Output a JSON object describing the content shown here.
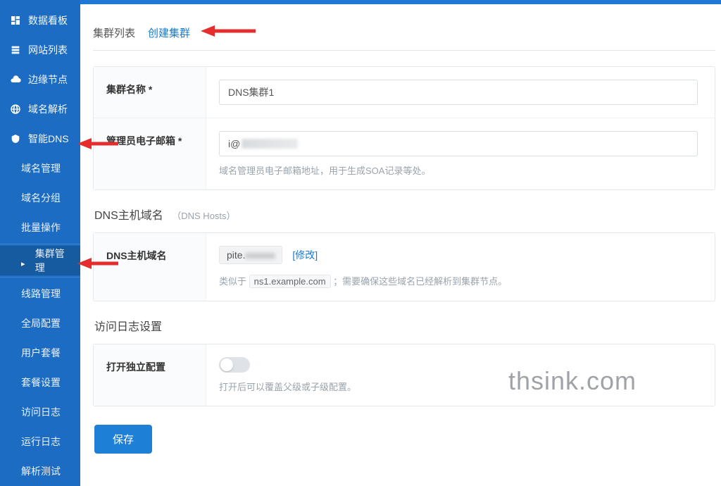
{
  "sidebar": {
    "items": [
      {
        "label": "数据看板",
        "icon": "dashboard"
      },
      {
        "label": "网站列表",
        "icon": "sites"
      },
      {
        "label": "边缘节点",
        "icon": "cloud"
      },
      {
        "label": "域名解析",
        "icon": "globe"
      },
      {
        "label": "智能DNS",
        "icon": "dns",
        "hasArrowAnnotation": true
      }
    ],
    "subitems": [
      {
        "label": "域名管理"
      },
      {
        "label": "域名分组"
      },
      {
        "label": "批量操作"
      },
      {
        "label": "集群管理",
        "selected": true,
        "hasArrowAnnotation": true
      },
      {
        "label": "线路管理"
      },
      {
        "label": "全局配置"
      },
      {
        "label": "用户套餐"
      },
      {
        "label": "套餐设置"
      },
      {
        "label": "访问日志"
      },
      {
        "label": "运行日志"
      },
      {
        "label": "解析测试"
      }
    ]
  },
  "tabs": {
    "list": "集群列表",
    "create": "创建集群",
    "active": "create"
  },
  "form": {
    "cluster_name_label": "集群名称",
    "cluster_name_value": "DNS集群1",
    "admin_email_label": "管理员电子邮箱",
    "admin_email_value": "i@",
    "admin_email_masked": true,
    "admin_email_hint": "域名管理员电子邮箱地址，用于生成SOA记录等处。",
    "required_mark": "*"
  },
  "dns_section": {
    "title": "DNS主机域名",
    "title_annot": "（DNS Hosts）",
    "row_label": "DNS主机域名",
    "host_value": "pite.",
    "host_masked_suffix": true,
    "modify_label": "[修改]",
    "hint_prefix": "类似于",
    "hint_code": "ns1.example.com",
    "hint_suffix": "；需要确保这些域名已经解析到集群节点。"
  },
  "log_section": {
    "title": "访问日志设置",
    "toggle_label": "打开独立配置",
    "toggle_on": false,
    "toggle_hint": "打开后可以覆盖父级或子级配置。"
  },
  "actions": {
    "save": "保存"
  },
  "watermark": "thsink.com"
}
